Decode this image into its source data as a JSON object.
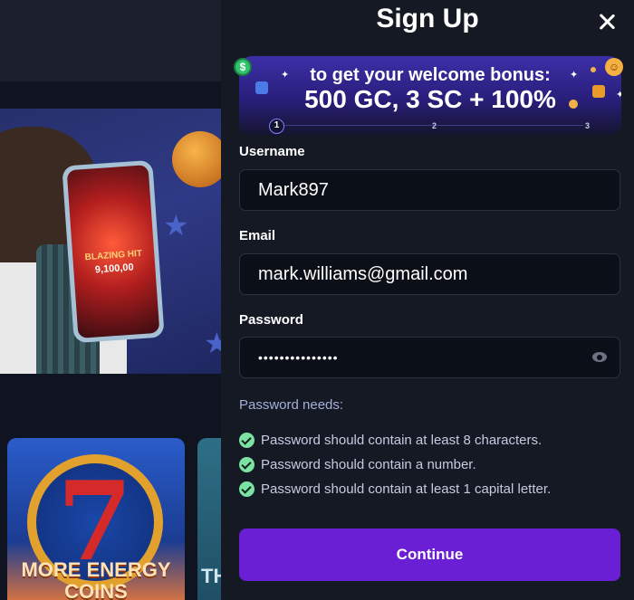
{
  "background": {
    "hero_game": {
      "title": "BLAZING HIT",
      "amount": "9,100,00"
    },
    "cards": [
      {
        "title_line1": "MORE ENERGY",
        "title_line2": "COINS"
      },
      {
        "title_partial": "TH"
      }
    ]
  },
  "signup": {
    "title": "Sign Up",
    "banner": {
      "line1": "to get your welcome bonus:",
      "line2": "500 GC, 3 SC + 100%",
      "steps": [
        "1",
        "2",
        "3"
      ]
    },
    "username": {
      "label": "Username",
      "value": "Mark897"
    },
    "email": {
      "label": "Email",
      "value": "mark.williams@gmail.com"
    },
    "password": {
      "label": "Password",
      "value": "•••••••••••••••"
    },
    "password_needs": {
      "title": "Password needs:",
      "rules": [
        "Password should contain at least 8 characters.",
        "Password should contain a number.",
        "Password should contain at least 1 capital letter."
      ]
    },
    "continue_label": "Continue"
  },
  "colors": {
    "accent": "#6a1fd4",
    "check": "#7be3a4",
    "panel_bg": "#141924"
  }
}
